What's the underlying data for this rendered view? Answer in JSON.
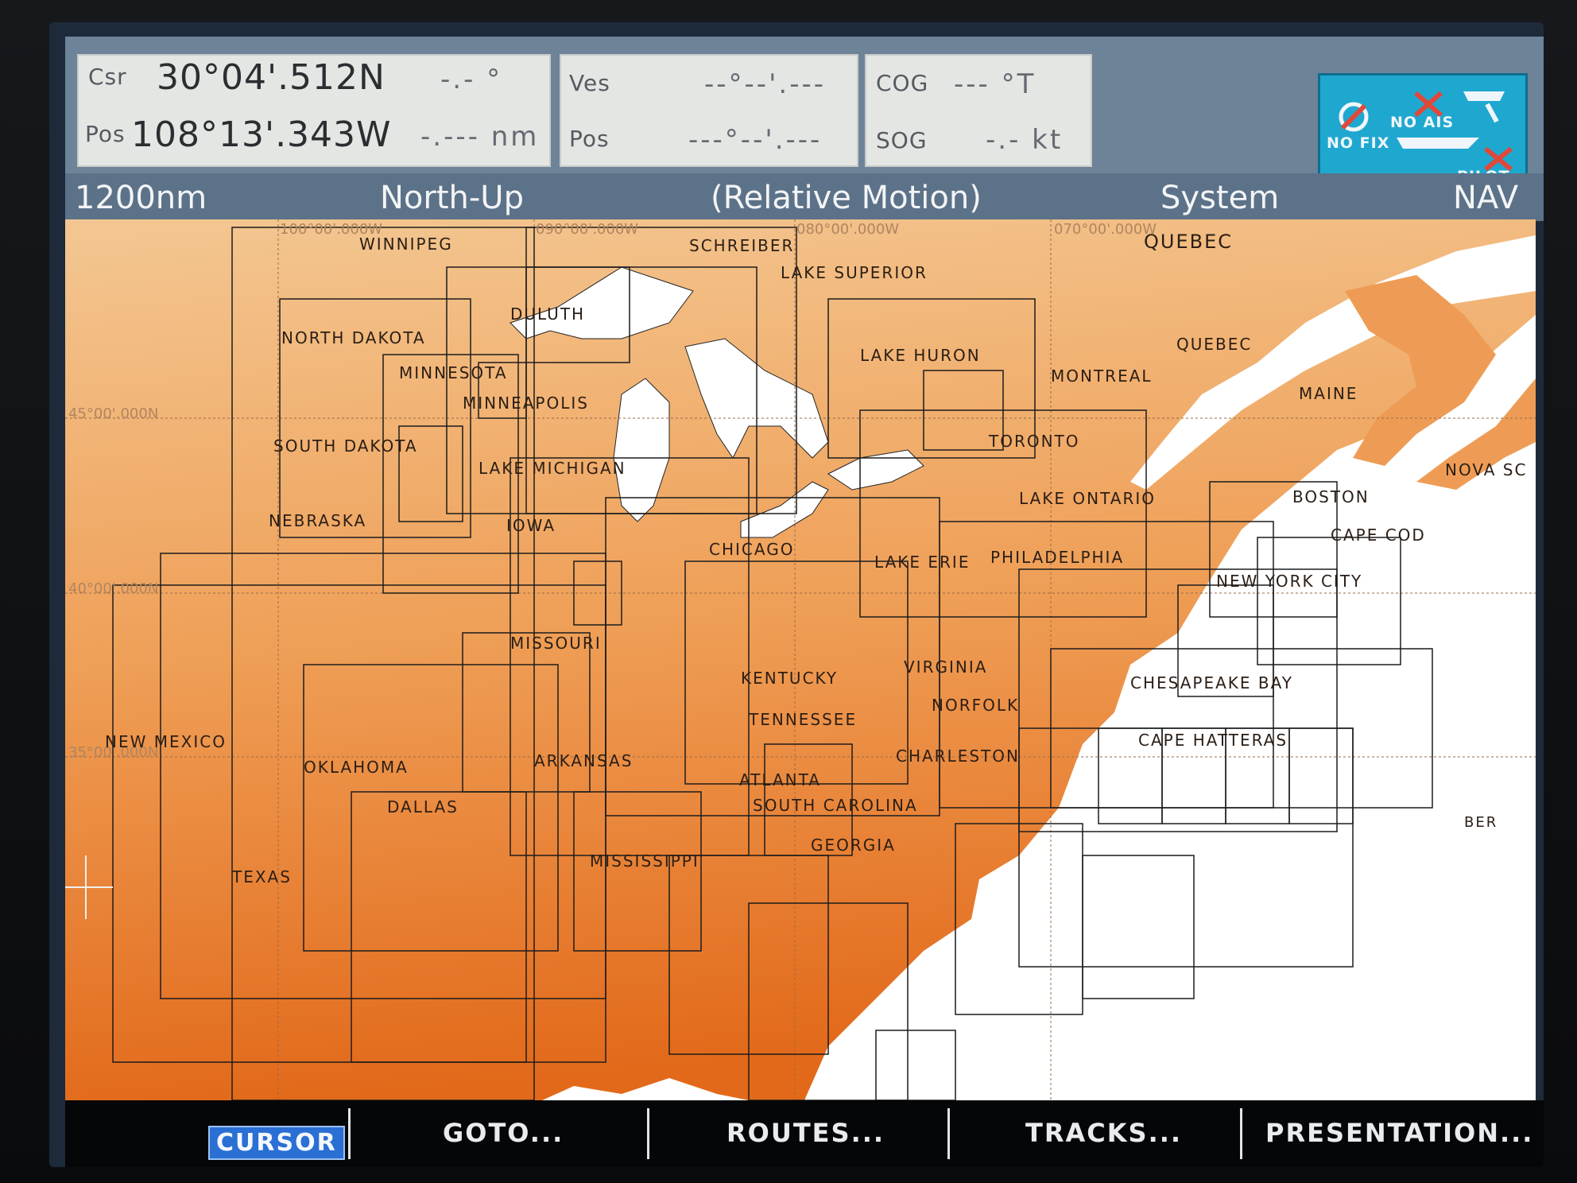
{
  "top": {
    "cursor_panel": {
      "csr_label": "Csr",
      "csr_lat": "30°04'.512N",
      "csr_bearing": "-.- °",
      "pos_label": "Pos",
      "pos_lon": "108°13'.343W",
      "pos_range": "-.--- nm"
    },
    "vessel_panel": {
      "ves_label": "Ves",
      "ves_value": "--°--'.---",
      "pos_label": "Pos",
      "pos_value": "---°--'.---"
    },
    "course_panel": {
      "cog_label": "COG",
      "cog_value": "--- °T",
      "sog_label": "SOG",
      "sog_value": "-.- kt"
    },
    "status": {
      "nofix": "NO FIX",
      "noais": "NO AIS",
      "pilot": "PILOT"
    }
  },
  "titlebar": {
    "range": "1200nm",
    "orientation": "North-Up",
    "motion": "(Relative Motion)",
    "system": "System",
    "nav": "NAV"
  },
  "map": {
    "colors": {
      "land_top": "#f2c08a",
      "land_bottom": "#e3701f",
      "sea": "#ffffff",
      "lakes": "#ffffff"
    },
    "grid_labels": {
      "lon100": "100°00'.000W",
      "lon090": "090°00'.000W",
      "lon080": "080°00'.000W",
      "lon070": "070°00'.000W",
      "lat45": "45°00'.000N",
      "lat40": "40°00'.000N",
      "lat35": "35°00'.000N"
    },
    "place_labels": [
      "WINNIPEG",
      "SCHREIBER",
      "QUEBEC",
      "LAKE SUPERIOR",
      "DULUTH",
      "NORTH DAKOTA",
      "MINNESOTA",
      "LAKE HURON",
      "QUEBEC",
      "MONTREAL",
      "MINNEAPOLIS",
      "MAINE",
      "SOUTH DAKOTA",
      "TORONTO",
      "LAKE MICHIGAN",
      "NOVA SC",
      "LAKE ONTARIO",
      "BOSTON",
      "NEBRASKA",
      "IOWA",
      "CAPE COD",
      "CHICAGO",
      "LAKE ERIE",
      "PHILADELPHIA",
      "NEW YORK CITY",
      "MISSOURI",
      "VIRGINIA",
      "KENTUCKY",
      "CHESAPEAKE BAY",
      "NORFOLK",
      "TENNESSEE",
      "NEW MEXICO",
      "CAPE HATTERAS",
      "OKLAHOMA",
      "ARKANSAS",
      "CHARLESTON",
      "ATLANTA",
      "DALLAS",
      "SOUTH CAROLINA",
      "BER",
      "GEORGIA",
      "MISSISSIPPI",
      "TEXAS"
    ]
  },
  "softkeys": {
    "cursor": "CURSOR",
    "goto": "GOTO...",
    "routes": "ROUTES...",
    "tracks": "TRACKS...",
    "presentation": "PRESENTATION..."
  }
}
